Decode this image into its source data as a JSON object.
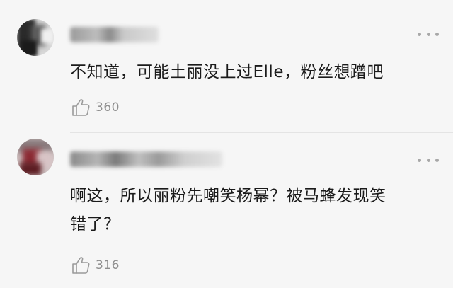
{
  "comments": [
    {
      "text": "不知道，可能土丽没上过Elle，粉丝想蹭吧",
      "likes": "360",
      "like_icon": "thumbs-up-icon",
      "more_icon": "more-dots-icon"
    },
    {
      "text_line1": "啊这，所以丽粉先嘲笑杨幂？被马蜂发现笑",
      "text_line2": "错了？",
      "likes": "316",
      "like_icon": "thumbs-up-icon",
      "more_icon": "more-dots-icon"
    }
  ],
  "colors": {
    "background": "#f6f6f6",
    "text": "#1a1a1a",
    "secondary": "#8e8e8e",
    "divider": "#e4e4e4"
  }
}
